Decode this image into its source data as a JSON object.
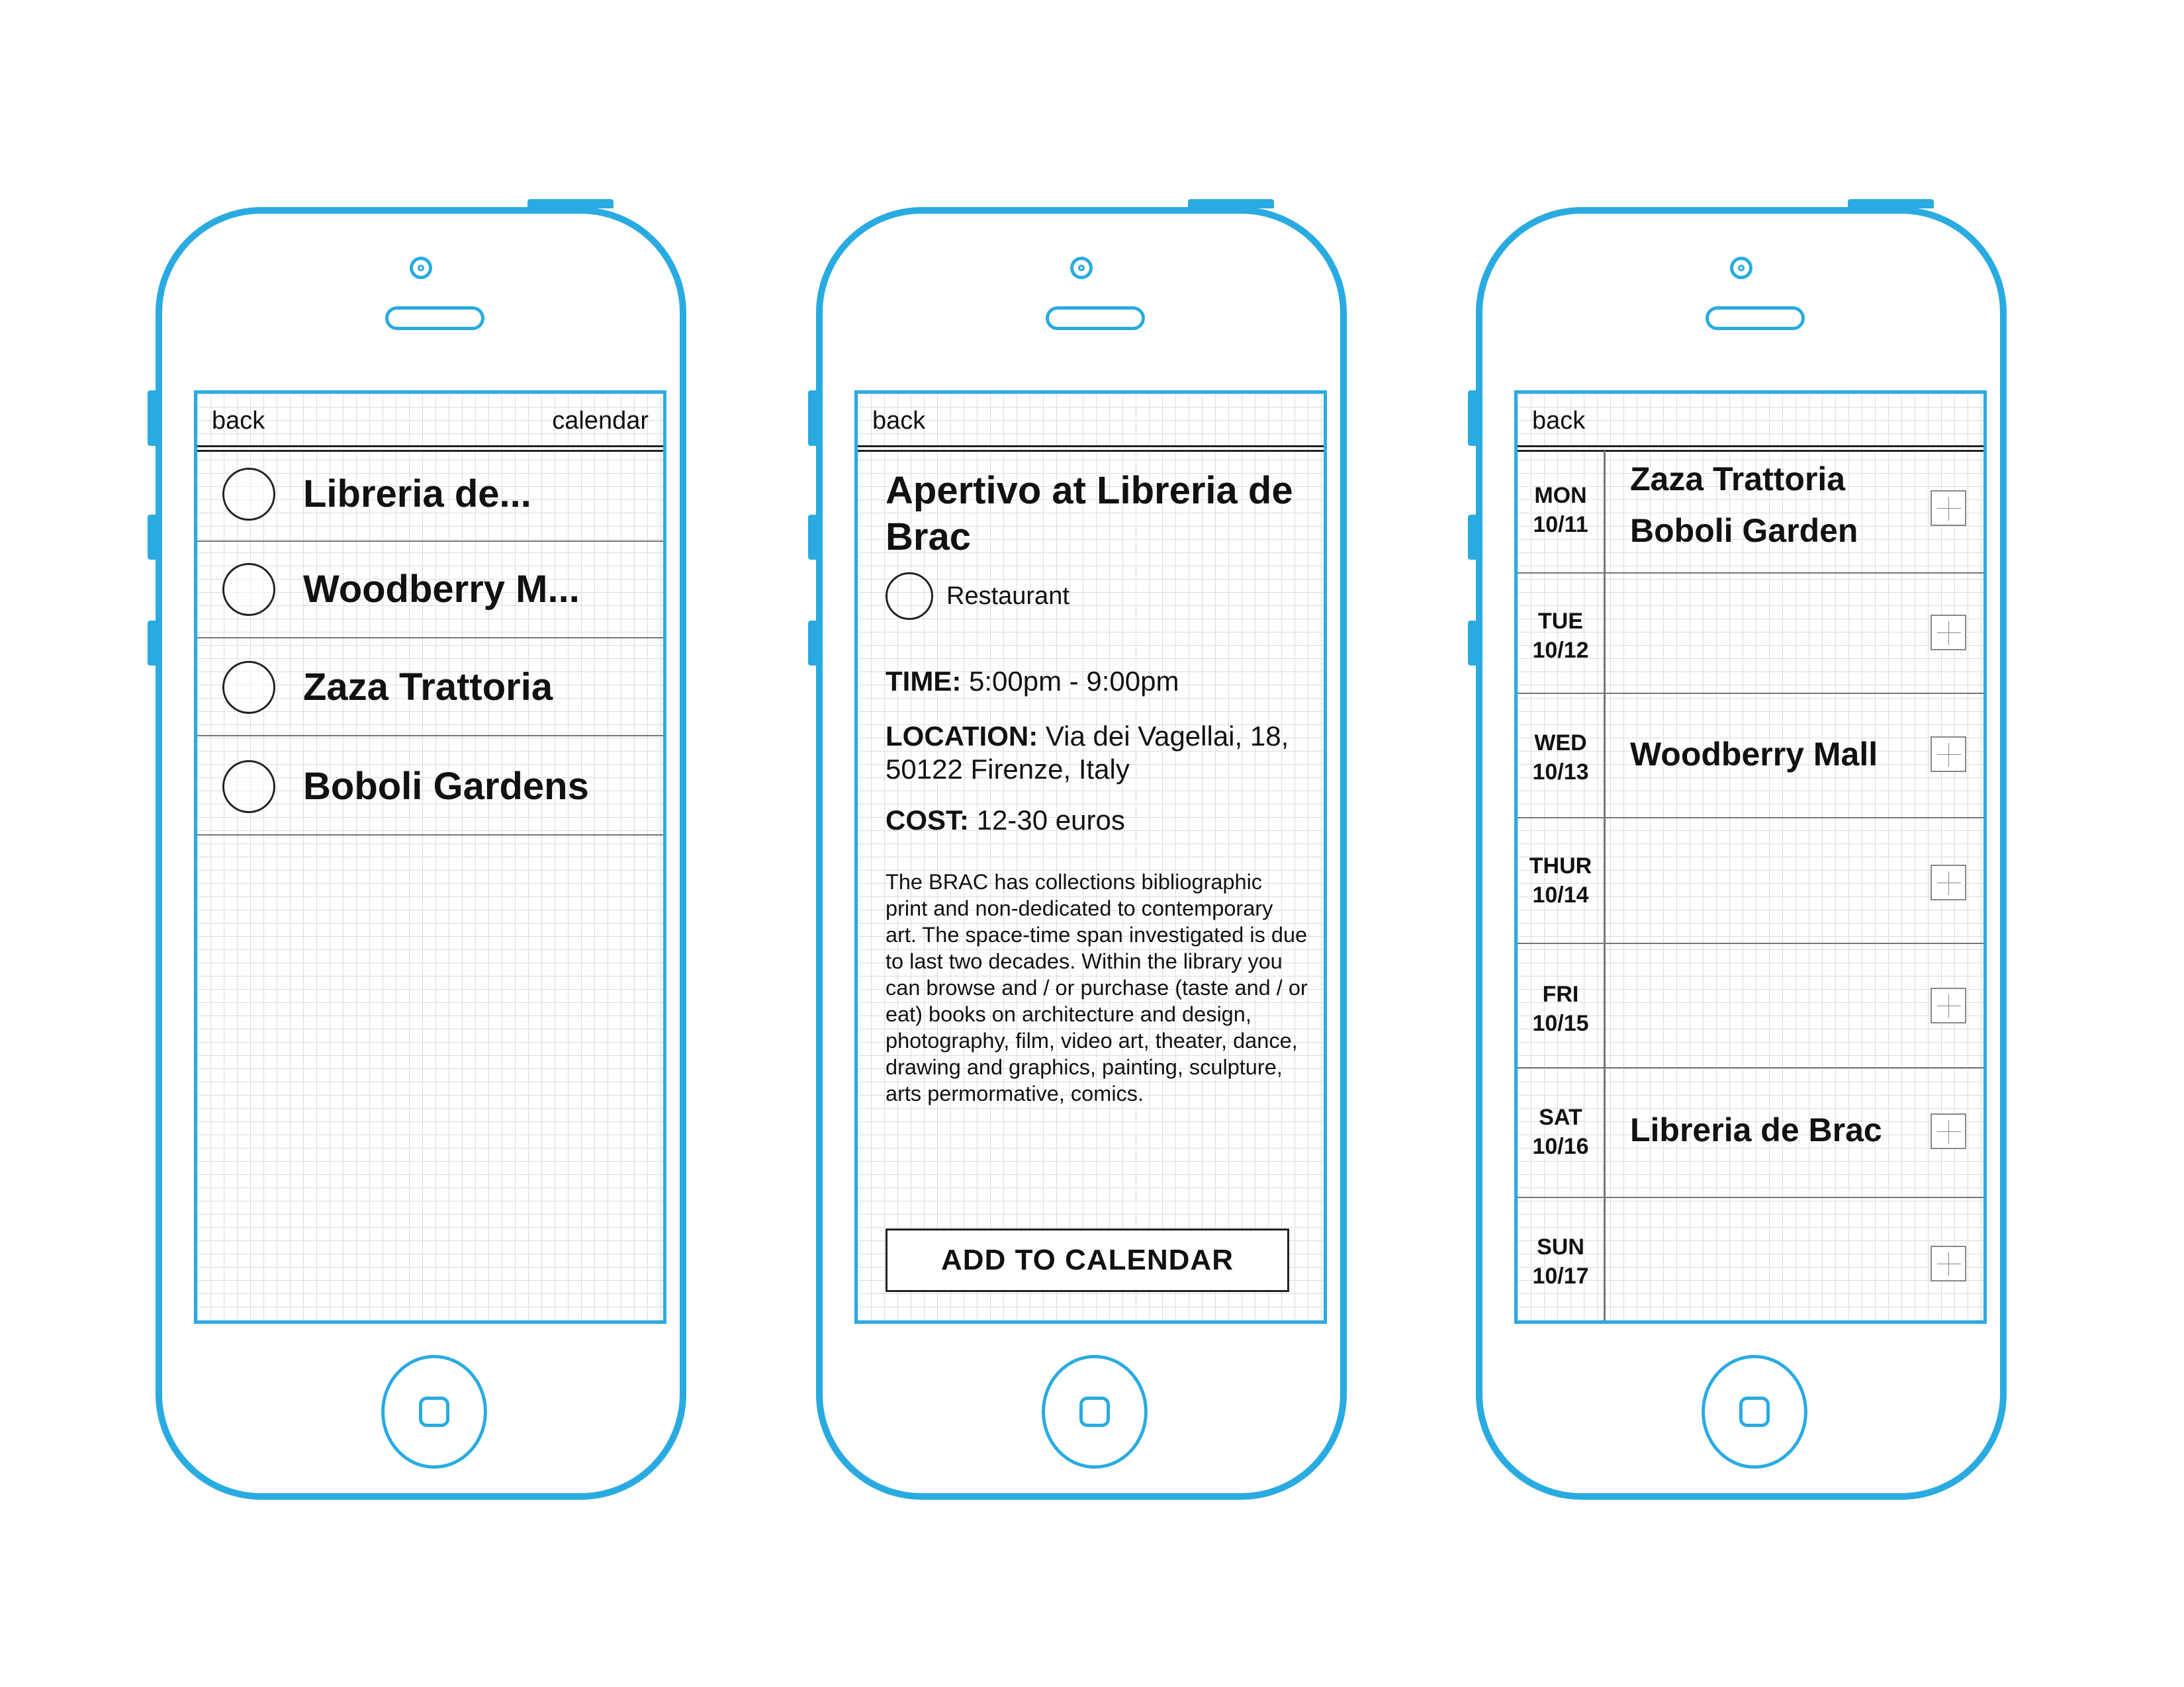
{
  "colors": {
    "device_outline": "#29abe2",
    "grid": "#dcdcdc",
    "text": "#111111"
  },
  "screens": {
    "list": {
      "back": "back",
      "calendar": "calendar",
      "items": [
        "Libreria de...",
        "Woodberry M...",
        "Zaza Trattoria",
        "Boboli Gardens"
      ]
    },
    "detail": {
      "back": "back",
      "title": "Apertivo at Libreria de Brac",
      "category": "Restaurant",
      "time_label": "TIME:",
      "time_value": "5:00pm - 9:00pm",
      "location_label": "LOCATION:",
      "location_value": "Via dei Vagellai, 18, 50122 Firenze, Italy",
      "cost_label": "COST:",
      "cost_value": "12-30 euros",
      "description": "The BRAC has collections bibliographic print and non-dedicated to contemporary art. The space-time span investigated is due to last two decades. Within the library you can browse and / or purchase (taste and / or eat) books on architecture and design, photography, film, video art, theater, dance, drawing and graphics, painting, sculpture, arts permormative, comics.",
      "button": "ADD TO CALENDAR"
    },
    "calendar": {
      "back": "back",
      "days": [
        {
          "dow": "MON",
          "date": "10/11",
          "events": [
            "Zaza Trattoria",
            "Boboli Garden"
          ]
        },
        {
          "dow": "TUE",
          "date": "10/12",
          "events": []
        },
        {
          "dow": "WED",
          "date": "10/13",
          "events": [
            "Woodberry Mall"
          ]
        },
        {
          "dow": "THUR",
          "date": "10/14",
          "events": []
        },
        {
          "dow": "FRI",
          "date": "10/15",
          "events": []
        },
        {
          "dow": "SAT",
          "date": "10/16",
          "events": [
            "Libreria de Brac"
          ]
        },
        {
          "dow": "SUN",
          "date": "10/17",
          "events": []
        }
      ]
    }
  }
}
